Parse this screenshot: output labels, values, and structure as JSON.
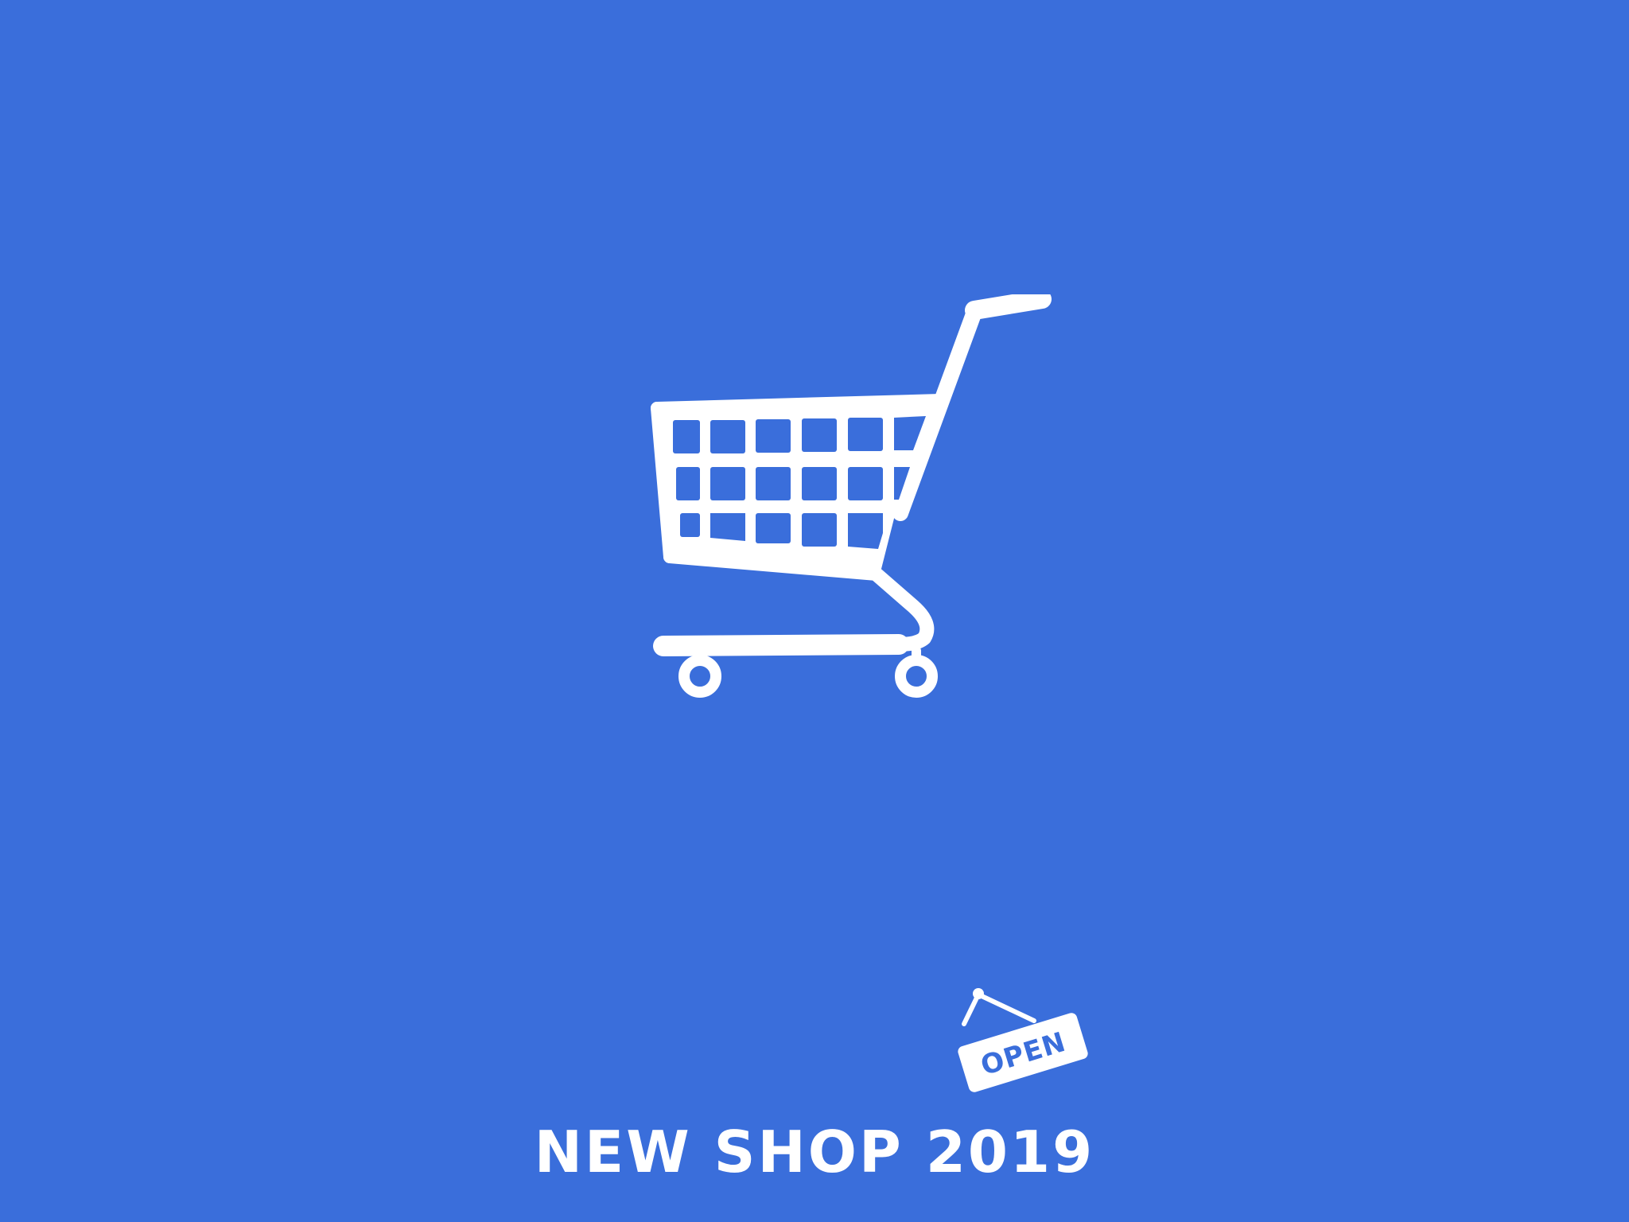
{
  "poster": {
    "background_color": "#3a6edb",
    "foreground_color": "#ffffff",
    "main_icon": "shopping-cart-icon",
    "badge_icon": "open-sign-icon",
    "badge_text": "OPEN",
    "headline": "NEW SHOP 2019"
  }
}
